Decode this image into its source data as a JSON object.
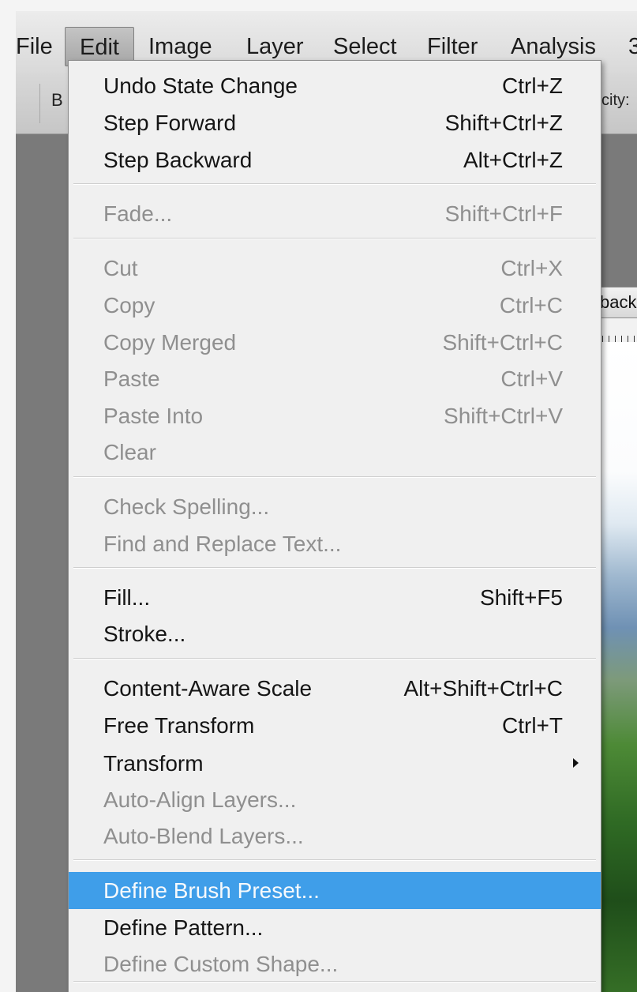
{
  "menubar": {
    "items": [
      "File",
      "Edit",
      "Image",
      "Layer",
      "Select",
      "Filter",
      "Analysis",
      "3"
    ],
    "active": "Edit"
  },
  "options_bar": {
    "brush_label": "B",
    "opacity_label": "city:"
  },
  "document": {
    "tab_label": "back"
  },
  "edit_menu": {
    "items": [
      {
        "label": "Undo State Change",
        "shortcut": "Ctrl+Z",
        "enabled": true
      },
      {
        "label": "Step Forward",
        "shortcut": "Shift+Ctrl+Z",
        "enabled": true
      },
      {
        "label": "Step Backward",
        "shortcut": "Alt+Ctrl+Z",
        "enabled": true
      },
      {
        "label": "Fade...",
        "shortcut": "Shift+Ctrl+F",
        "enabled": false
      },
      {
        "label": "Cut",
        "shortcut": "Ctrl+X",
        "enabled": false
      },
      {
        "label": "Copy",
        "shortcut": "Ctrl+C",
        "enabled": false
      },
      {
        "label": "Copy Merged",
        "shortcut": "Shift+Ctrl+C",
        "enabled": false
      },
      {
        "label": "Paste",
        "shortcut": "Ctrl+V",
        "enabled": false
      },
      {
        "label": "Paste Into",
        "shortcut": "Shift+Ctrl+V",
        "enabled": false
      },
      {
        "label": "Clear",
        "shortcut": "",
        "enabled": false
      },
      {
        "label": "Check Spelling...",
        "shortcut": "",
        "enabled": false
      },
      {
        "label": "Find and Replace Text...",
        "shortcut": "",
        "enabled": false
      },
      {
        "label": "Fill...",
        "shortcut": "Shift+F5",
        "enabled": true
      },
      {
        "label": "Stroke...",
        "shortcut": "",
        "enabled": true
      },
      {
        "label": "Content-Aware Scale",
        "shortcut": "Alt+Shift+Ctrl+C",
        "enabled": true
      },
      {
        "label": "Free Transform",
        "shortcut": "Ctrl+T",
        "enabled": true
      },
      {
        "label": "Transform",
        "shortcut": "",
        "enabled": true,
        "submenu": true
      },
      {
        "label": "Auto-Align Layers...",
        "shortcut": "",
        "enabled": false
      },
      {
        "label": "Auto-Blend Layers...",
        "shortcut": "",
        "enabled": false
      },
      {
        "label": "Define Brush Preset...",
        "shortcut": "",
        "enabled": true,
        "highlighted": true
      },
      {
        "label": "Define Pattern...",
        "shortcut": "",
        "enabled": true
      },
      {
        "label": "Define Custom Shape...",
        "shortcut": "",
        "enabled": false
      }
    ]
  },
  "colors": {
    "highlight": "#3f9ee9",
    "menu_background": "#f0f0f0",
    "disabled_text": "#8f8f8f",
    "workspace": "#7a7a7a"
  }
}
